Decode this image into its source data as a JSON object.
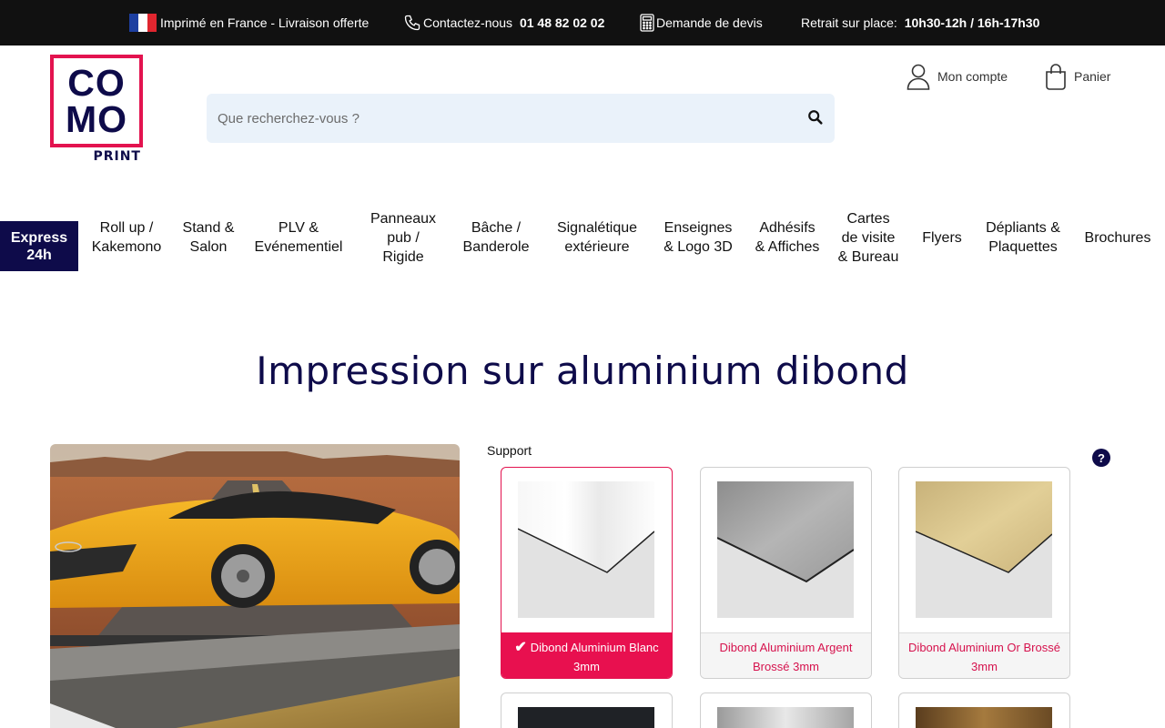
{
  "topbar": {
    "made_in": "Imprimé en France - Livraison offerte",
    "contact_label": "Contactez-nous",
    "contact_phone": "01 48 82 02 02",
    "quote": "Demande de devis",
    "pickup_label": "Retrait sur place:",
    "pickup_hours": "10h30-12h / 16h-17h30"
  },
  "logo": {
    "line1": "CO",
    "line2": "MO",
    "sub": "PRINT"
  },
  "search": {
    "placeholder": "Que recherchez-vous ?"
  },
  "account": {
    "label": "Mon compte"
  },
  "cart": {
    "label": "Panier"
  },
  "nav": {
    "express": "Express 24h",
    "items": [
      "Roll up / Kakemono",
      "Stand & Salon",
      "PLV & Evénementiel",
      "Panneaux pub / Rigide",
      "Bâche / Banderole",
      "Signalétique extérieure",
      "Enseignes & Logo 3D",
      "Adhésifs & Affiches",
      "Cartes de visite & Bureau",
      "Flyers",
      "Dépliants & Plaquettes",
      "Brochures"
    ]
  },
  "page": {
    "title": "Impression sur aluminium dibond"
  },
  "options": {
    "label": "Support",
    "help": "?",
    "selected_check": "✔",
    "cards": [
      "Dibond Aluminium Blanc 3mm",
      "Dibond Aluminium Argent Brossé 3mm",
      "Dibond Aluminium Or Brossé 3mm"
    ]
  },
  "colors": {
    "brand_navy": "#0e0b4a",
    "brand_pink": "#e3134f",
    "topbar": "#111111",
    "search_bg": "#eaf2fa"
  }
}
